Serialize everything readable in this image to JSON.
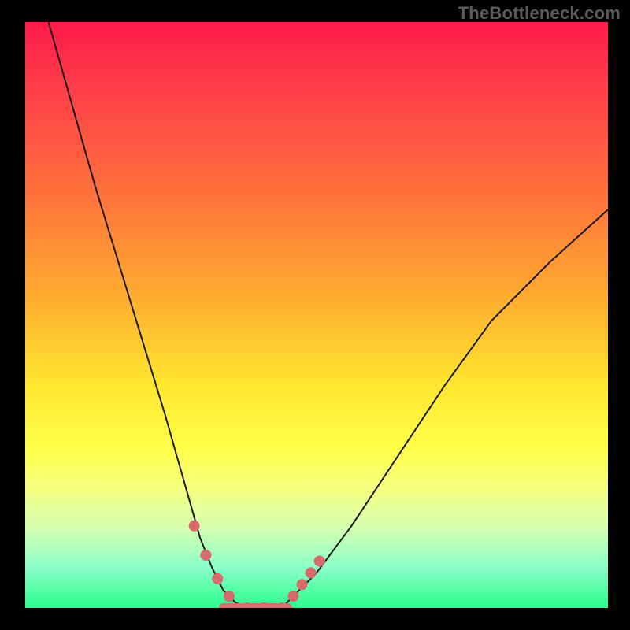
{
  "watermark": "TheBottleneck.com",
  "colors": {
    "background": "#000000",
    "curve": "#191919",
    "markers": "#d76a6a",
    "gradient": [
      "#ff1a4a",
      "#ff6a3d",
      "#ffa531",
      "#ffe62e",
      "#ffff4a",
      "#d7ffae",
      "#2bfd8e"
    ]
  },
  "chart_data": {
    "type": "line",
    "title": "",
    "xlabel": "",
    "ylabel": "",
    "xlim": [
      0,
      100
    ],
    "ylim": [
      0,
      100
    ],
    "grid": false,
    "legend": false,
    "series": [
      {
        "name": "bottleneck-curve",
        "x": [
          4,
          8,
          12,
          16,
          20,
          24,
          26,
          28,
          30,
          32,
          34,
          36,
          38,
          40,
          44,
          50,
          56,
          64,
          72,
          80,
          90,
          100
        ],
        "y": [
          100,
          86,
          72,
          59,
          46,
          33,
          26,
          19,
          12,
          7,
          3,
          1,
          0,
          0,
          0,
          6,
          14,
          26,
          38,
          49,
          59,
          68
        ]
      }
    ],
    "markers": {
      "name": "highlighted-points",
      "x": [
        29,
        31,
        33,
        35,
        38,
        41,
        44,
        46,
        47.5,
        49,
        50.5
      ],
      "y": [
        14,
        9,
        5,
        2,
        0,
        0,
        0,
        2,
        4,
        6,
        8
      ]
    },
    "floor_segment": {
      "x_start": 34,
      "x_end": 45,
      "y": 0
    }
  }
}
